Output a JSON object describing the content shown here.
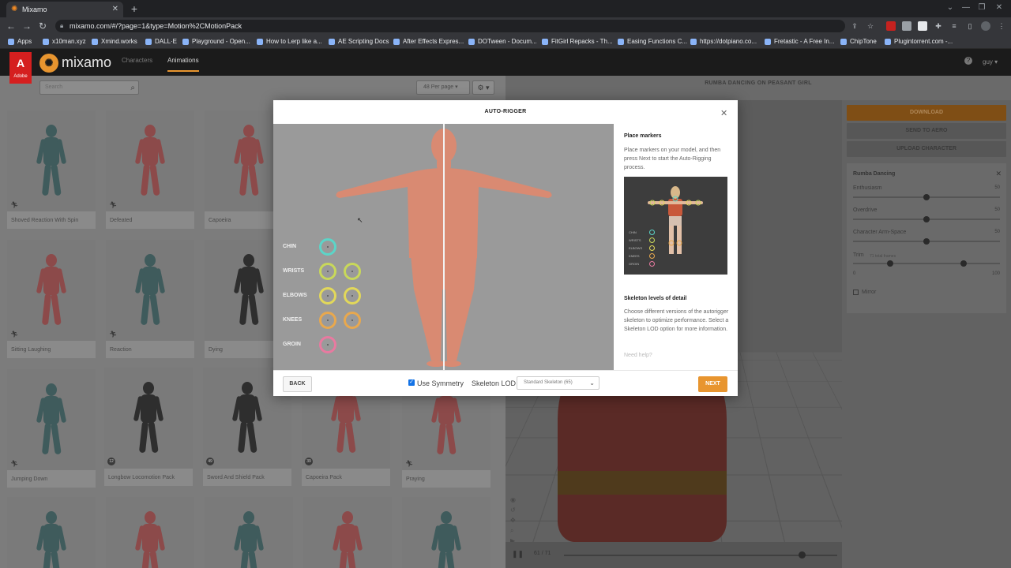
{
  "browser": {
    "tab_title": "Mixamo",
    "url": "mixamo.com/#/?page=1&type=Motion%2CMotionPack",
    "bookmarks": [
      "Apps",
      "x10man.xyz",
      "Xmind.works",
      "DALL·E",
      "Playground - Open...",
      "How to Lerp like a...",
      "AE Scripting Docs",
      "After Effects Expres...",
      "DOTween - Docum...",
      "FitGirl Repacks - Th...",
      "Easing Functions C...",
      "https://dotpiano.co...",
      "Fretastic - A Free In...",
      "ChipTone",
      "Plugintorrent.com -..."
    ]
  },
  "header": {
    "adobe_logo": "Adobe",
    "brand": "mixamo",
    "tabs": [
      "Characters",
      "Animations"
    ],
    "active_tab": "Animations",
    "user": "guy"
  },
  "library": {
    "search_placeholder": "Search",
    "per_page": "48 Per page",
    "cards": [
      {
        "label": "Shoved Reaction With Spin",
        "color": "teal"
      },
      {
        "label": "Defeated",
        "color": "red"
      },
      {
        "label": "Capoeira",
        "color": "red"
      },
      {
        "label": "Sitting Laughing",
        "color": "red"
      },
      {
        "label": "Reaction",
        "color": "teal"
      },
      {
        "label": "Dying",
        "color": "dark"
      },
      {
        "label": "Jumping Down",
        "color": "teal"
      },
      {
        "label": "Longbow Locomotion Pack",
        "color": "dark",
        "badge": "12"
      },
      {
        "label": "Sword And Shield Pack",
        "color": "dark",
        "badge": "49"
      },
      {
        "label": "Capoeira Pack",
        "color": "red",
        "badge": "39"
      },
      {
        "label": "Praying",
        "color": "red"
      }
    ]
  },
  "viewer": {
    "title": "RUMBA DANCING ON PEASANT GIRL",
    "frame": "61 / 71",
    "scrub_progress": 0.87
  },
  "sidepanel": {
    "download": "DOWNLOAD",
    "send_to_aero": "SEND TO AERO",
    "upload_character": "UPLOAD CHARACTER",
    "anim_name": "Rumba Dancing",
    "params": [
      {
        "label": "Enthusiasm",
        "value": "50",
        "fraction": 0.5
      },
      {
        "label": "Overdrive",
        "value": "50",
        "fraction": 0.5
      },
      {
        "label": "Character Arm-Space",
        "value": "50",
        "fraction": 0.5
      }
    ],
    "trim_label": "Trim",
    "trim_sub": "71 total frames",
    "trim_min": "0",
    "trim_max": "100",
    "trim_start": 0.25,
    "trim_end": 0.75,
    "mirror": "Mirror"
  },
  "modal": {
    "title": "AUTO-RIGGER",
    "markers": [
      {
        "label": "CHIN",
        "color": "#5bd5c8",
        "count": 1
      },
      {
        "label": "WRISTS",
        "color": "#c8d85a",
        "count": 2
      },
      {
        "label": "ELBOWS",
        "color": "#e2d85a",
        "count": 2
      },
      {
        "label": "KNEES",
        "color": "#e8a84e",
        "count": 2
      },
      {
        "label": "GROIN",
        "color": "#e87aa0",
        "count": 1
      }
    ],
    "info_title": "Place markers",
    "info_text": "Place markers on your model, and then press Next to start the Auto-Rigging process.",
    "legend": [
      "CHIN",
      "WRISTS",
      "ELBOWS",
      "KNEES",
      "GROIN"
    ],
    "lod_title": "Skeleton levels of detail",
    "lod_text": "Choose different versions of the autorigger skeleton to optimize performance. Select a Skeleton LOD option for more information.",
    "need_help": "Need help?",
    "back": "BACK",
    "use_symmetry": "Use Symmetry",
    "use_symmetry_checked": true,
    "skeleton_lod_label": "Skeleton LOD",
    "skeleton_lod_value": "Standard Skeleton (65)",
    "next": "NEXT"
  }
}
